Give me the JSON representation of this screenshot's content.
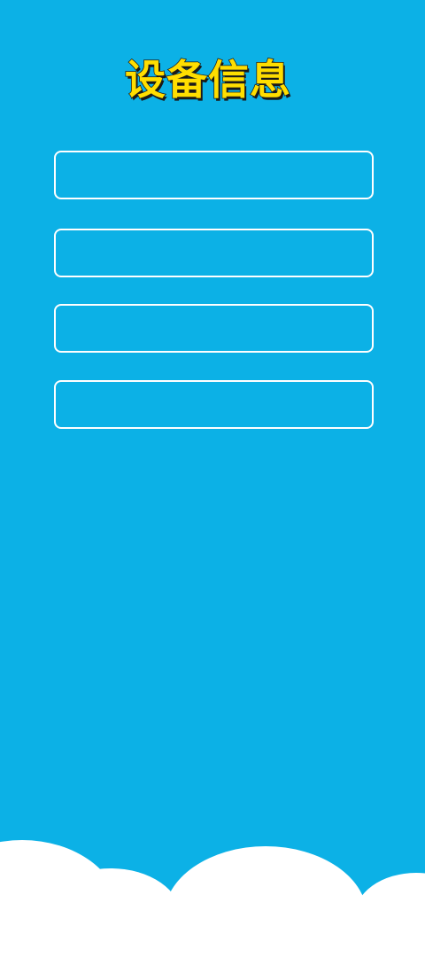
{
  "header": {
    "title": "设备信息"
  },
  "fields": [
    {
      "value": ""
    },
    {
      "value": ""
    },
    {
      "value": ""
    },
    {
      "value": ""
    }
  ],
  "colors": {
    "background": "#0cb1e6",
    "title": "#ffde00",
    "field_border": "#ffffff",
    "clouds": "#ffffff"
  }
}
